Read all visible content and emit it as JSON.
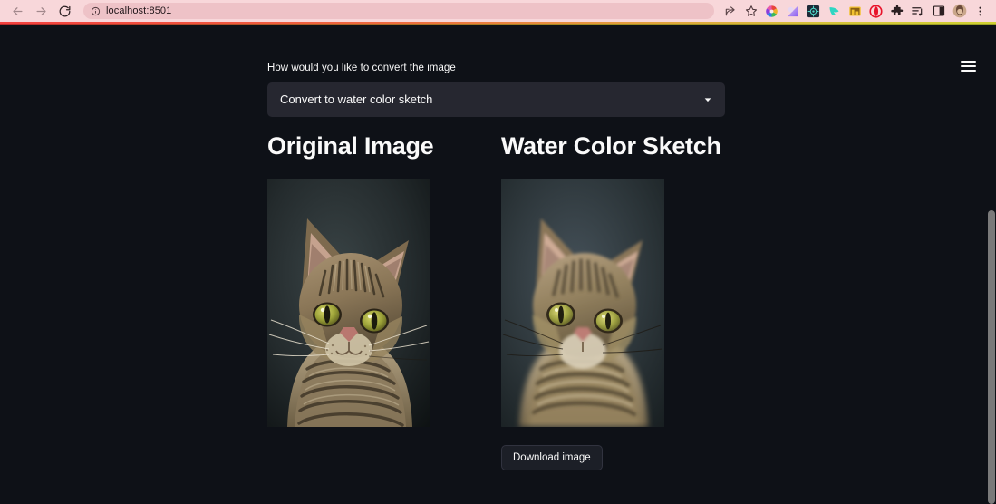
{
  "browser": {
    "back_label": "Back",
    "forward_label": "Forward",
    "reload_label": "Reload",
    "site_info_label": "View site information",
    "url": "localhost:8501",
    "toolbar_icons": [
      {
        "name": "share-icon",
        "color": "#3b2a2e"
      },
      {
        "name": "bookmark-star-icon",
        "color": "#3b2a2e"
      },
      {
        "name": "color-wheel-extension-icon",
        "color": "#e8453c"
      },
      {
        "name": "purple-gradient-extension-icon",
        "color": "#9b7ce0"
      },
      {
        "name": "dark-grid-extension-icon",
        "color": "#2d3a4a"
      },
      {
        "name": "teal-bird-extension-icon",
        "color": "#2fd6c3"
      },
      {
        "name": "yellow-wallet-extension-icon",
        "color": "#e8b33c"
      },
      {
        "name": "opera-extension-icon",
        "color": "#e8132b"
      },
      {
        "name": "puzzle-extensions-icon",
        "color": "#2b1f22"
      },
      {
        "name": "playlist-icon",
        "color": "#2b1f22"
      },
      {
        "name": "split-view-icon",
        "color": "#2b1f22"
      },
      {
        "name": "profile-avatar-icon",
        "color": "#6b4a3a"
      },
      {
        "name": "chrome-menu-icon",
        "color": "#2b1f22"
      }
    ]
  },
  "app": {
    "menu_label": "Main menu",
    "select_widget": {
      "label": "How would you like to convert the image",
      "value": "Convert to water color sketch",
      "caret_icon": "chevron-down-icon"
    },
    "columns": [
      {
        "heading": "Original Image",
        "image_name": "original-cat-photo",
        "image_alt": "Tabby cat portrait on dark background"
      },
      {
        "heading": "Water Color Sketch",
        "image_name": "watercolor-cat-photo",
        "image_alt": "Water color sketch rendering of the tabby cat",
        "download_button": "Download image"
      }
    ]
  },
  "theme": {
    "background": "#0e1117",
    "secondary_background": "#262730",
    "text": "#fafafa",
    "toolbar_background": "#f8d7da",
    "accent_gradient_start": "#f4413f",
    "accent_gradient_end": "#cfd132",
    "scrollbar_thumb": "#7a7a7a"
  }
}
